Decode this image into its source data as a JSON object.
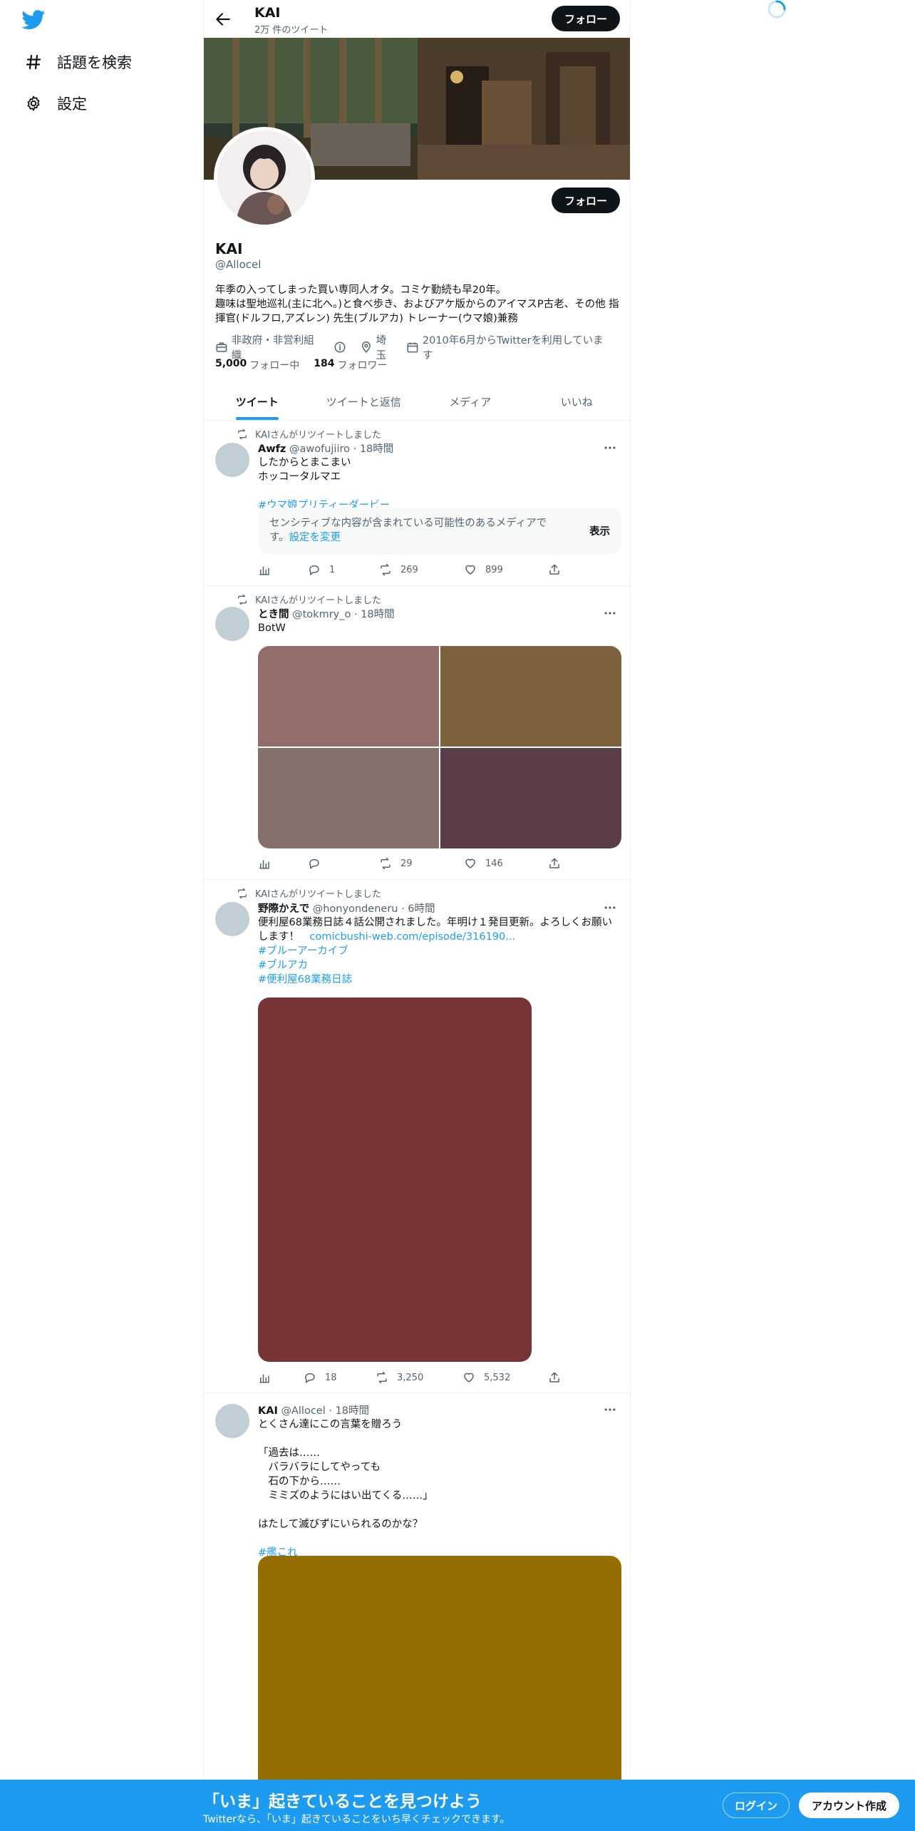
{
  "nav": {
    "logo_icon": "twitter-bird-icon",
    "items": [
      {
        "label": "話題を検索",
        "icon": "hashtag-icon"
      },
      {
        "label": "設定",
        "icon": "gear-icon"
      }
    ]
  },
  "header": {
    "title": "KAI",
    "subtitle": "2万 件のツイート",
    "follow_label": "フォロー"
  },
  "profile": {
    "name": "KAI",
    "handle": "@Allocel",
    "follow_label": "フォロー",
    "bio": "年季の入ってしまった買い専同人オタ。コミケ勤続も早20年。\n趣味は聖地巡礼(主に北へ。)と食べ歩き、およびアケ版からのアイマスP古老、その他 指揮官(ドルフロ,アズレン) 先生(ブルアカ) トレーナー(ウマ娘)兼務",
    "category": "非政府・非営利組織",
    "location": "埼玉",
    "joined": "2010年6月からTwitterを利用しています",
    "following_count": "5,000",
    "following_label": "フォロー中",
    "followers_count": "184",
    "followers_label": "フォロワー"
  },
  "tabs": [
    {
      "label": "ツイート",
      "active": true
    },
    {
      "label": "ツイートと返信",
      "active": false
    },
    {
      "label": "メディア",
      "active": false
    },
    {
      "label": "いいね",
      "active": false
    }
  ],
  "tweets": [
    {
      "retweet_label": "KAIさんがリツイートしました",
      "display_name": "Awfz",
      "handle_time": "@awofujiiro · 18時間",
      "text": "したからとまこまい\nホッコータルマエ",
      "hashtags": [
        "#ウマ娘プリティーダービー"
      ],
      "sensitive_text": "センシティブな内容が含まれている可能性のあるメディアです。",
      "sensitive_link": "設定を変更",
      "sensitive_button": "表示",
      "replies": "1",
      "retweets": "269",
      "likes": "899"
    },
    {
      "retweet_label": "KAIさんがリツイートしました",
      "display_name": "とき間",
      "handle_time": "@tokmry_o · 18時間",
      "text": "BotW",
      "media_colors": [
        "#926d69",
        "#7d603c",
        "#85716a",
        "#5a3d48"
      ],
      "replies": "",
      "retweets": "29",
      "likes": "146"
    },
    {
      "retweet_label": "KAIさんがリツイートしました",
      "display_name": "野際かえで",
      "handle_time": "@honyondeneru · 6時間",
      "text": "便利屋68業務日誌４話公開されました。年明け１発目更新。よろしくお願いします！",
      "link": "comicbushi-web.com/episode/316190...",
      "hashtags": [
        "#ブルーアーカイブ",
        "#ブルアカ",
        "#便利屋68業務日誌"
      ],
      "media_color": "#763437",
      "replies": "18",
      "retweets": "3,250",
      "likes": "5,532"
    },
    {
      "display_name": "KAI",
      "handle_time": "@Allocel · 18時間",
      "text": "とくさん達にこの言葉を贈ろう\n\n「過去は……\n　バラバラにしてやっても\n　石の下から……\n　ミミズのようにはい出てくる……」\n\nはたして滅びずにいられるのかな？",
      "hashtags": [
        "#艦これ"
      ],
      "media_color": "#946e00"
    }
  ],
  "bottom_bar": {
    "title": "「いま」起きていることを見つけよう",
    "subtitle": "Twitterなら、「いま」起きていることをいち早くチェックできます。",
    "login_label": "ログイン",
    "signup_label": "アカウント作成",
    "color": "#1d9bf0"
  }
}
